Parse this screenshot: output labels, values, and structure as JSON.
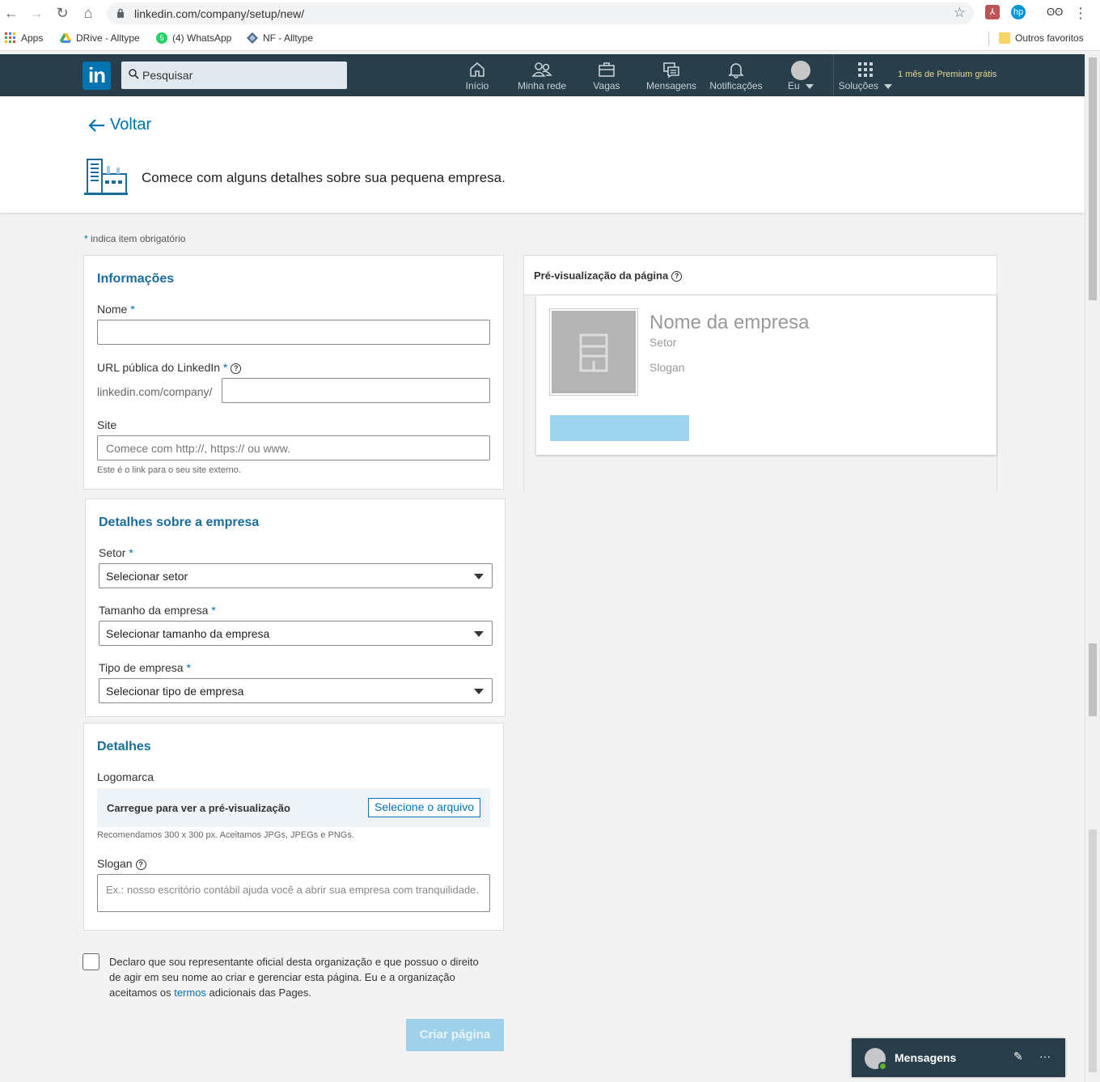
{
  "browser": {
    "url": "linkedin.com/company/setup/new/",
    "bookmarks": [
      {
        "label": "Apps"
      },
      {
        "label": "DRive - Alltype"
      },
      {
        "label": "(4) WhatsApp"
      },
      {
        "label": "NF - Alltype"
      }
    ],
    "other_bookmarks": "Outros favoritos"
  },
  "header": {
    "logo": "in",
    "search_placeholder": "Pesquisar",
    "nav": [
      {
        "label": "Início",
        "icon": "home-icon"
      },
      {
        "label": "Minha rede",
        "icon": "network-icon"
      },
      {
        "label": "Vagas",
        "icon": "jobs-icon"
      },
      {
        "label": "Mensagens",
        "icon": "messaging-icon"
      },
      {
        "label": "Notificações",
        "icon": "bell-icon"
      },
      {
        "label": "Eu",
        "icon": "avatar-icon"
      },
      {
        "label": "Soluções",
        "icon": "grid-icon"
      }
    ],
    "premium": "1 mês de Premium grátis",
    "colors": {
      "bar": "#283e4a",
      "brand": "#0073b1",
      "premium": "#ead596"
    }
  },
  "page": {
    "back_label": "Voltar",
    "intro": "Comece com alguns detalhes sobre sua pequena empresa.",
    "required_note": "indica item obrigatório"
  },
  "info_card": {
    "title": "Informações",
    "name_label": "Nome",
    "url_label": "URL pública do LinkedIn",
    "url_prefix": "linkedin.com/company/",
    "site_label": "Site",
    "site_placeholder": "Comece com http://, https:// ou www.",
    "site_hint": "Este é o link para o seu site externo."
  },
  "company_card": {
    "title": "Detalhes sobre a empresa",
    "sector_label": "Setor",
    "sector_value": "Selecionar setor",
    "size_label": "Tamanho da empresa",
    "size_value": "Selecionar tamanho da empresa",
    "type_label": "Tipo de empresa",
    "type_value": "Selecionar tipo de empresa"
  },
  "details_card": {
    "title": "Detalhes",
    "logo_label": "Logomarca",
    "upload_text": "Carregue para ver a pré-visualização",
    "upload_button": "Selecione o arquivo",
    "upload_hint": "Recomendamos 300 x 300 px. Aceitamos JPGs, JPEGs e PNGs.",
    "slogan_label": "Slogan",
    "slogan_placeholder": "Ex.: nosso escritório contábil ajuda você a abrir sua empresa com tranquilidade."
  },
  "declaration": {
    "text_before": "Declaro que sou representante oficial desta organização e que possuo o direito de agir em seu nome ao criar e gerenciar esta página. Eu e a organização aceitamos os ",
    "link": "termos",
    "text_after": " adicionais das Pages."
  },
  "create_button": "Criar página",
  "preview": {
    "title": "Pré-visualização da página",
    "company_name": "Nome da empresa",
    "sector": "Setor",
    "slogan": "Slogan"
  },
  "messaging": {
    "title": "Mensagens"
  }
}
